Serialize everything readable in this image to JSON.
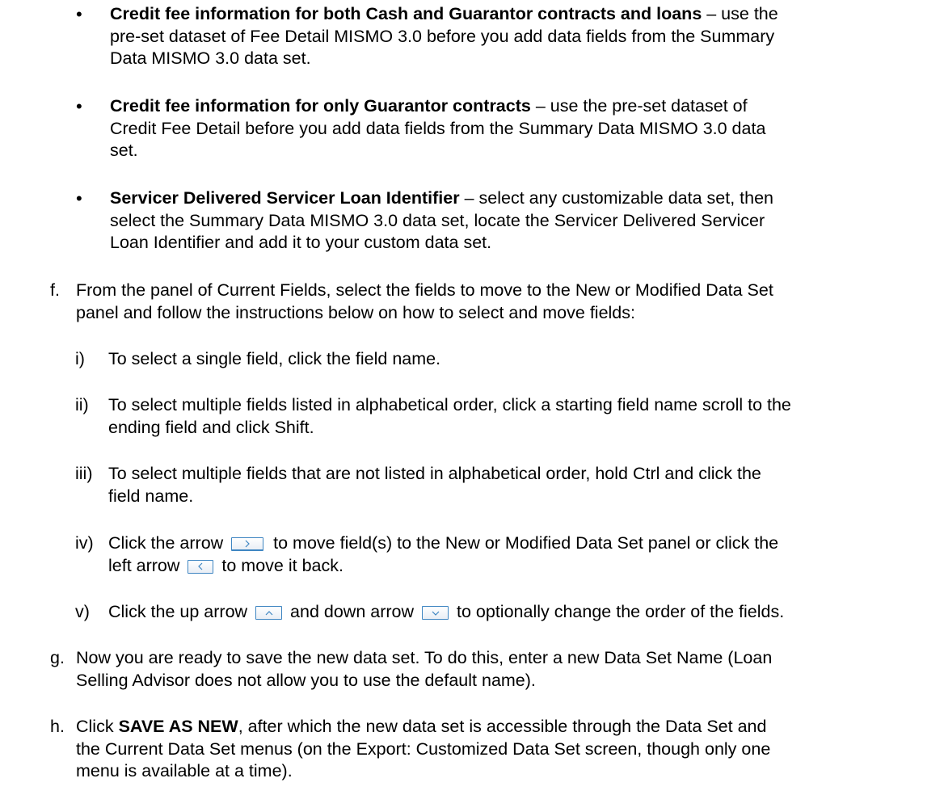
{
  "bullets": [
    {
      "bold": "Credit fee information for both Cash and Guarantor contracts and loans",
      "line1_rest": " – use the",
      "line2": "pre-set dataset of Fee Detail MISMO 3.0 before you add data fields from the Summary",
      "line3": "Data MISMO 3.0 data set."
    },
    {
      "bold": "Credit fee information for only Guarantor contracts",
      "line1_rest": " – use the pre-set dataset of",
      "line2": "Credit Fee Detail before you add data fields from the Summary Data MISMO 3.0 data",
      "line3": "set."
    },
    {
      "bold": "Servicer Delivered Servicer Loan Identifier",
      "line1_rest": " – select any customizable data set, then",
      "line2": "select the Summary Data MISMO 3.0 data set, locate the Servicer Delivered Servicer",
      "line3": "Loan Identifier and add it to your custom data set."
    }
  ],
  "step_f": {
    "marker": "f.",
    "line1": "From the panel of Current Fields, select the fields to move to the New or Modified Data Set",
    "line2": "panel and follow the instructions below on how to select and move fields:"
  },
  "substeps": {
    "i": {
      "marker": "i)",
      "text": "To select a single field, click the field name."
    },
    "ii": {
      "marker": "ii)",
      "line1": "To select multiple fields listed in alphabetical order, click a starting field name scroll to the",
      "line2": "ending field and click Shift."
    },
    "iii": {
      "marker": "iii)",
      "line1": "To select multiple fields that are not listed in alphabetical order, hold Ctrl and click the",
      "line2": "field name."
    },
    "iv": {
      "marker": "iv)",
      "pre": "Click the arrow",
      "post": "to move field(s) to the New or Modified Data Set panel or click the",
      "line2_pre": "left arrow",
      "line2_post": "to move it back."
    },
    "v": {
      "marker": "v)",
      "pre": "Click the up arrow",
      "mid": "and down arrow",
      "post": "to optionally change the order of the fields."
    }
  },
  "step_g": {
    "marker": "g.",
    "line1": "Now you are ready to save the new data set. To do this, enter a new Data Set Name (Loan",
    "line2": "Selling Advisor does not allow you to use the default name)."
  },
  "step_h": {
    "marker": "h.",
    "pre": "Click ",
    "bold": "SAVE AS NEW",
    "line1_rest": ", after which the new data set is accessible through the Data Set and",
    "line2": "the Current Data Set menus (on the Export: Customized Data Set screen, though only one",
    "line3": "menu is available at a time)."
  },
  "icons": {
    "right": "arrow-right-button-icon",
    "left": "arrow-left-button-icon",
    "up": "arrow-up-button-icon",
    "down": "arrow-down-button-icon"
  },
  "accent_color": "#3f86c2"
}
